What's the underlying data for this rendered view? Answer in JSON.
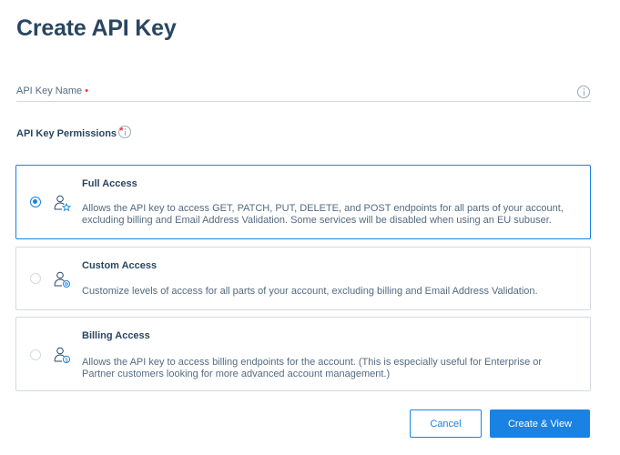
{
  "page": {
    "title": "Create API Key"
  },
  "name_field": {
    "label": "API Key Name",
    "required_marker": "•",
    "value": "",
    "info_icon": "info-icon"
  },
  "permissions": {
    "label": "API Key Permissions",
    "required_marker": "*",
    "info_icon": "info-icon",
    "selected": "full_access",
    "options": [
      {
        "id": "full_access",
        "title": "Full Access",
        "description": "Allows the API key to access GET, PATCH, PUT, DELETE, and POST endpoints for all parts of your account, excluding billing and Email Address Validation. Some services will be disabled when using an EU subuser.",
        "icon": "user-star-icon",
        "selected": true
      },
      {
        "id": "custom_access",
        "title": "Custom Access",
        "description": "Customize levels of access for all parts of your account, excluding billing and Email Address Validation.",
        "icon": "user-gear-icon",
        "selected": false
      },
      {
        "id": "billing_access",
        "title": "Billing Access",
        "description": "Allows the API key to access billing endpoints for the account. (This is especially useful for Enterprise or Partner customers looking for more advanced account management.)",
        "icon": "user-dollar-icon",
        "selected": false
      }
    ]
  },
  "actions": {
    "cancel_label": "Cancel",
    "create_label": "Create & View"
  },
  "colors": {
    "accent": "#1a82e2",
    "heading": "#294661",
    "text": "#546b81",
    "border": "#d4dadf",
    "required": "#f22f46"
  }
}
